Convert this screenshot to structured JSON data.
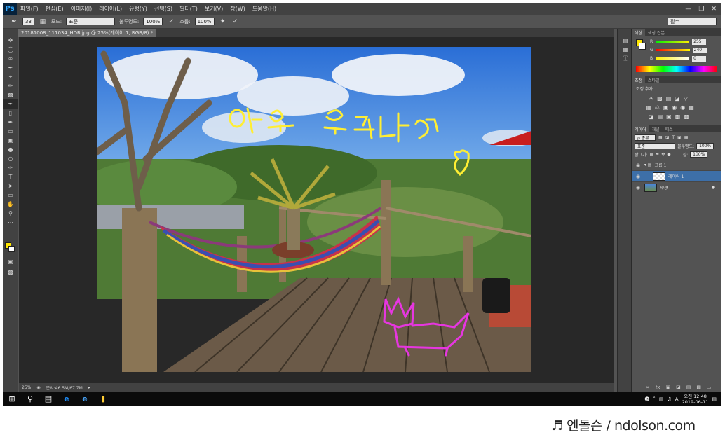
{
  "app": {
    "logo": "Ps"
  },
  "menu": [
    "파일(F)",
    "편집(E)",
    "이미지(I)",
    "레이어(L)",
    "유형(Y)",
    "선택(S)",
    "필터(T)",
    "보기(V)",
    "창(W)",
    "도움말(H)"
  ],
  "options": {
    "brush_size": "33",
    "mode_label": "모드:",
    "mode_value": "표준",
    "opacity_label": "불투명도:",
    "opacity_value": "100%",
    "flow_label": "흐름:",
    "flow_value": "100%",
    "workspace": "필수"
  },
  "document_tab": "20181008_111034_HDR.jpg @ 25%(레이어 1, RGB/8) *",
  "status": {
    "zoom": "25%",
    "doc_size": "문서:46.5M/67.7M"
  },
  "photo_annotations": {
    "yellow_text": "야호 오키나와"
  },
  "colors": {
    "foreground": "#ffe600",
    "background": "#ffffff",
    "layer_selected": "#3d6fa8"
  },
  "panels": {
    "color": {
      "tabs": [
        "색상",
        "색상 견본"
      ],
      "r": "255",
      "g": "240",
      "b": "0",
      "r_letter": "R",
      "g_letter": "G",
      "b_letter": "B"
    },
    "adjustments": {
      "tabs": [
        "조정",
        "스타일"
      ],
      "title": "조정 추가"
    },
    "layers": {
      "tabs": [
        "레이어",
        "채널",
        "패스"
      ],
      "kind_filter": "ρ 종류",
      "blend_mode": "표준",
      "opacity_label": "불투명도:",
      "opacity_value": "100%",
      "lock_label": "잠그기:",
      "fill_label": "칠:",
      "fill_value": "100%",
      "items": [
        {
          "name": "그룹 1",
          "type": "group"
        },
        {
          "name": "레이어 1",
          "type": "layer",
          "selected": true
        },
        {
          "name": "배경",
          "type": "background"
        }
      ]
    }
  },
  "taskbar": {
    "ime": "A",
    "time": "오전 12:48",
    "date": "2019-06-11"
  },
  "watermark": "♬ 엔돌슨 / ndolson.com"
}
